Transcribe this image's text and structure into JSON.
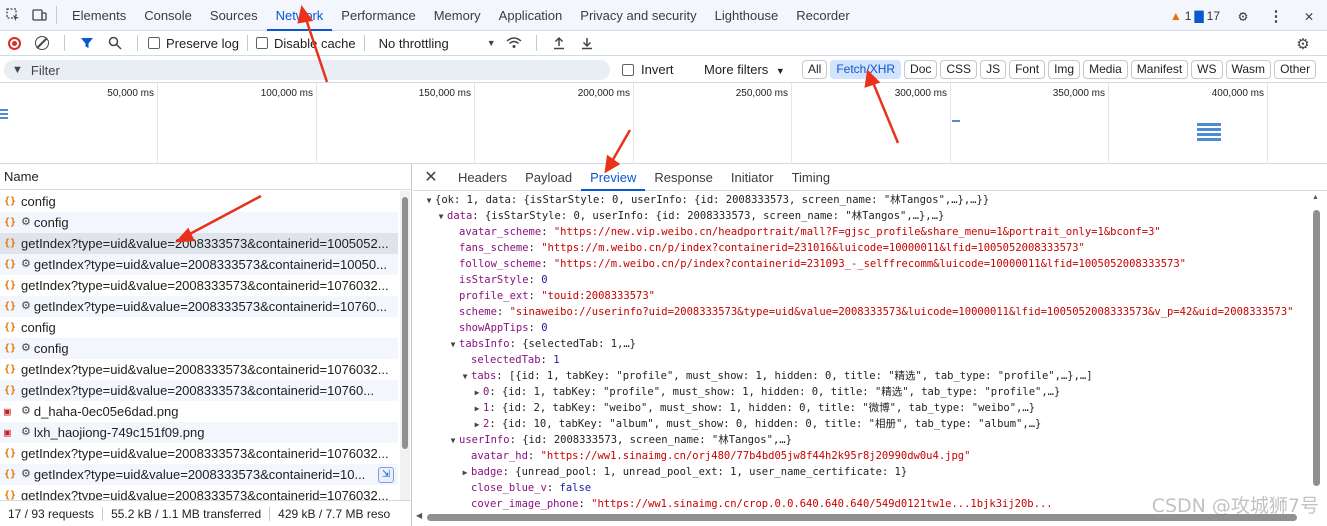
{
  "topbar": {
    "tabs": [
      "Elements",
      "Console",
      "Sources",
      "Network",
      "Performance",
      "Memory",
      "Application",
      "Privacy and security",
      "Lighthouse",
      "Recorder"
    ],
    "active_tab": "Network",
    "warnings": "1",
    "messages": "17"
  },
  "toolbar": {
    "preserve_log": "Preserve log",
    "disable_cache": "Disable cache",
    "throttling": "No throttling"
  },
  "filterbar": {
    "placeholder": "Filter",
    "invert": "Invert",
    "more_filters": "More filters",
    "types": [
      "All",
      "Fetch/XHR",
      "Doc",
      "CSS",
      "JS",
      "Font",
      "Img",
      "Media",
      "Manifest",
      "WS",
      "Wasm",
      "Other"
    ],
    "active_type": "Fetch/XHR"
  },
  "overview": {
    "ticks": [
      "50,000 ms",
      "100,000 ms",
      "150,000 ms",
      "200,000 ms",
      "250,000 ms",
      "300,000 ms",
      "350,000 ms",
      "400,000 ms"
    ]
  },
  "requests": {
    "header": "Name",
    "rows": [
      {
        "icon": "{}",
        "gear": false,
        "name": "config"
      },
      {
        "icon": "{}",
        "gear": true,
        "name": "config"
      },
      {
        "icon": "{}",
        "gear": false,
        "name": "getIndex?type=uid&value=2008333573&containerid=1005052..."
      },
      {
        "icon": "{}",
        "gear": true,
        "name": "getIndex?type=uid&value=2008333573&containerid=10050..."
      },
      {
        "icon": "{}",
        "gear": false,
        "name": "getIndex?type=uid&value=2008333573&containerid=1076032..."
      },
      {
        "icon": "{}",
        "gear": true,
        "name": "getIndex?type=uid&value=2008333573&containerid=10760..."
      },
      {
        "icon": "{}",
        "gear": false,
        "name": "config"
      },
      {
        "icon": "{}",
        "gear": true,
        "name": "config"
      },
      {
        "icon": "{}",
        "gear": false,
        "name": "getIndex?type=uid&value=2008333573&containerid=1076032..."
      },
      {
        "icon": "{}",
        "gear": false,
        "name": "getIndex?type=uid&value=2008333573&containerid=10760..."
      },
      {
        "icon": "img",
        "gear": true,
        "name": "d_haha-0ec05e6dad.png"
      },
      {
        "icon": "img",
        "gear": true,
        "name": "lxh_haojiong-749c151f09.png"
      },
      {
        "icon": "{}",
        "gear": false,
        "name": "getIndex?type=uid&value=2008333573&containerid=1076032..."
      },
      {
        "icon": "{}",
        "gear": true,
        "name": "getIndex?type=uid&value=2008333573&containerid=10..."
      },
      {
        "icon": "{}",
        "gear": false,
        "name": "getIndex?type=uid&value=2008333573&containerid=1076032..."
      }
    ],
    "selected_row": 2
  },
  "status": {
    "requests": "17 / 93 requests",
    "transferred": "55.2 kB / 1.1 MB transferred",
    "resources": "429 kB / 7.7 MB reso"
  },
  "details": {
    "tabs": [
      "Headers",
      "Payload",
      "Preview",
      "Response",
      "Initiator",
      "Timing"
    ],
    "active_tab": "Preview",
    "lines": [
      {
        "indent": 0,
        "arrow": "down",
        "parts": [
          [
            "p",
            "{ok: 1, data: {isStarStyle: 0, userInfo: {id: 2008333573, screen_name: \"林Tangos\",…},…}}"
          ]
        ]
      },
      {
        "indent": 1,
        "arrow": "down",
        "parts": [
          [
            "k",
            "data"
          ],
          [
            "p",
            ": {isStarStyle: 0, userInfo: {id: 2008333573, screen_name: \"林Tangos\",…},…}"
          ]
        ]
      },
      {
        "indent": 2,
        "arrow": "",
        "parts": [
          [
            "k",
            "avatar_scheme"
          ],
          [
            "p",
            ": "
          ],
          [
            "s",
            "\"https://new.vip.weibo.cn/headportrait/mall?F=gjsc_profile&share_menu=1&portrait_only=1&bconf=3\""
          ]
        ]
      },
      {
        "indent": 2,
        "arrow": "",
        "parts": [
          [
            "k",
            "fans_scheme"
          ],
          [
            "p",
            ": "
          ],
          [
            "s",
            "\"https://m.weibo.cn/p/index?containerid=231016&luicode=10000011&lfid=1005052008333573\""
          ]
        ]
      },
      {
        "indent": 2,
        "arrow": "",
        "parts": [
          [
            "k",
            "follow_scheme"
          ],
          [
            "p",
            ": "
          ],
          [
            "s",
            "\"https://m.weibo.cn/p/index?containerid=231093_-_selffrecomm&luicode=10000011&lfid=1005052008333573\""
          ]
        ]
      },
      {
        "indent": 2,
        "arrow": "",
        "parts": [
          [
            "k",
            "isStarStyle"
          ],
          [
            "p",
            ": "
          ],
          [
            "n",
            "0"
          ]
        ]
      },
      {
        "indent": 2,
        "arrow": "",
        "parts": [
          [
            "k",
            "profile_ext"
          ],
          [
            "p",
            ": "
          ],
          [
            "s",
            "\"touid:2008333573\""
          ]
        ]
      },
      {
        "indent": 2,
        "arrow": "",
        "parts": [
          [
            "k",
            "scheme"
          ],
          [
            "p",
            ": "
          ],
          [
            "s",
            "\"sinaweibo://userinfo?uid=2008333573&type=uid&value=2008333573&luicode=10000011&lfid=1005052008333573&v_p=42&uid=2008333573\""
          ]
        ]
      },
      {
        "indent": 2,
        "arrow": "",
        "parts": [
          [
            "k",
            "showAppTips"
          ],
          [
            "p",
            ": "
          ],
          [
            "n",
            "0"
          ]
        ]
      },
      {
        "indent": 2,
        "arrow": "down",
        "parts": [
          [
            "k",
            "tabsInfo"
          ],
          [
            "p",
            ": {selectedTab: 1,…}"
          ]
        ]
      },
      {
        "indent": 3,
        "arrow": "",
        "parts": [
          [
            "k",
            "selectedTab"
          ],
          [
            "p",
            ": "
          ],
          [
            "n",
            "1"
          ]
        ]
      },
      {
        "indent": 3,
        "arrow": "down",
        "parts": [
          [
            "k",
            "tabs"
          ],
          [
            "p",
            ": [{id: 1, tabKey: \"profile\", must_show: 1, hidden: 0, title: \"精选\", tab_type: \"profile\",…},…]"
          ]
        ]
      },
      {
        "indent": 4,
        "arrow": "right",
        "parts": [
          [
            "k",
            "0"
          ],
          [
            "p",
            ": {id: 1, tabKey: \"profile\", must_show: 1, hidden: 0, title: \"精选\", tab_type: \"profile\",…}"
          ]
        ]
      },
      {
        "indent": 4,
        "arrow": "right",
        "parts": [
          [
            "k",
            "1"
          ],
          [
            "p",
            ": {id: 2, tabKey: \"weibo\", must_show: 1, hidden: 0, title: \"微博\", tab_type: \"weibo\",…}"
          ]
        ]
      },
      {
        "indent": 4,
        "arrow": "right",
        "parts": [
          [
            "k",
            "2"
          ],
          [
            "p",
            ": {id: 10, tabKey: \"album\", must_show: 0, hidden: 0, title: \"相册\", tab_type: \"album\",…}"
          ]
        ]
      },
      {
        "indent": 2,
        "arrow": "down",
        "parts": [
          [
            "k",
            "userInfo"
          ],
          [
            "p",
            ": {id: 2008333573, screen_name: \"林Tangos\",…}"
          ]
        ]
      },
      {
        "indent": 3,
        "arrow": "",
        "parts": [
          [
            "k",
            "avatar_hd"
          ],
          [
            "p",
            ": "
          ],
          [
            "s",
            "\"https://ww1.sinaimg.cn/orj480/77b4bd05jw8f44h2k95r8j20990dw0u4.jpg\""
          ]
        ]
      },
      {
        "indent": 3,
        "arrow": "right",
        "parts": [
          [
            "k",
            "badge"
          ],
          [
            "p",
            ": {unread_pool: 1, unread_pool_ext: 1, user_name_certificate: 1}"
          ]
        ]
      },
      {
        "indent": 3,
        "arrow": "",
        "parts": [
          [
            "k",
            "close_blue_v"
          ],
          [
            "p",
            ": "
          ],
          [
            "n",
            "false"
          ]
        ]
      },
      {
        "indent": 3,
        "arrow": "",
        "parts": [
          [
            "k",
            "cover_image_phone"
          ],
          [
            "p",
            ": "
          ],
          [
            "s",
            "\"https://ww1.sinaimg.cn/crop.0.0.640.640.640/549d0121tw1e...1bjk3ij20b..."
          ]
        ]
      }
    ]
  },
  "watermark": "CSDN @攻城狮7号",
  "colors": {
    "accent": "#0b57d0",
    "key": "#881280",
    "string": "#c80000",
    "number": "#1a1aa6",
    "arrow_annotation": "#e8321a"
  }
}
